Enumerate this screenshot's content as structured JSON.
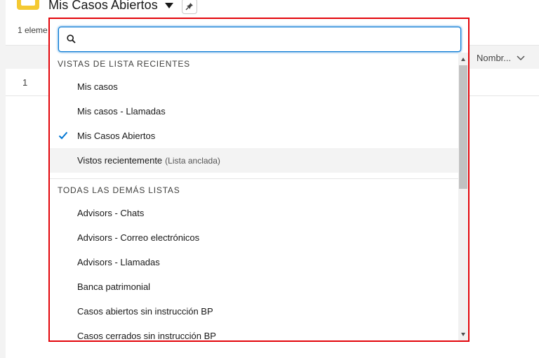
{
  "page": {
    "title": "Mis Casos Abiertos",
    "item_count": "1 eleme",
    "column_header": "Nombr...",
    "row_number": "1"
  },
  "dropdown": {
    "search_placeholder": "",
    "recent_heading": "VISTAS DE LISTA RECIENTES",
    "recent_items": [
      {
        "label": "Mis casos",
        "selected": false
      },
      {
        "label": "Mis casos - Llamadas",
        "selected": false
      },
      {
        "label": "Mis Casos Abiertos",
        "selected": true
      },
      {
        "label": "Vistos recientemente",
        "suffix": "(Lista anclada)",
        "selected": false
      }
    ],
    "all_heading": "TODAS LAS DEMÁS LISTAS",
    "all_items": [
      {
        "label": "Advisors - Chats"
      },
      {
        "label": "Advisors - Correo electrónicos"
      },
      {
        "label": "Advisors - Llamadas"
      },
      {
        "label": "Banca patrimonial"
      },
      {
        "label": "Casos abiertos sin instrucción BP"
      },
      {
        "label": "Casos cerrados sin instrucción BP"
      }
    ]
  },
  "icons": {
    "object": "case-folder-icon",
    "caret": "caret-down-icon",
    "pin": "pin-icon",
    "search": "search-icon",
    "check": "check-icon",
    "column_menu": "chevron-down-icon"
  },
  "colors": {
    "accent": "#0176d3",
    "highlight_border": "#e3050b",
    "object_icon": "#f4c932"
  }
}
